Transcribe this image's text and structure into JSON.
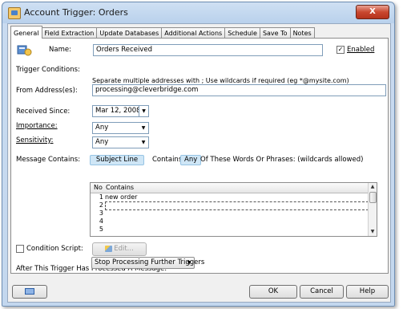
{
  "window": {
    "title": "Account Trigger: Orders",
    "close_label": "X"
  },
  "tabs": [
    {
      "label": "General"
    },
    {
      "label": "Field Extraction"
    },
    {
      "label": "Update Databases"
    },
    {
      "label": "Additional Actions"
    },
    {
      "label": "Schedule"
    },
    {
      "label": "Save To"
    },
    {
      "label": "Notes"
    }
  ],
  "general": {
    "name_label": "Name:",
    "name_value": "Orders Received",
    "enabled_label": "Enabled",
    "enabled_checked": true,
    "trigger_conditions_label": "Trigger Conditions:",
    "address_hint": "Separate multiple addresses with ; Use wildcards if required (eg *@mysite.com)",
    "from_label": "From Address(es):",
    "from_value": "processing@cleverbridge.com",
    "received_since_label": "Received Since:",
    "received_since_value": "Mar 12, 2008",
    "importance_label": "Importance:",
    "importance_value": "Any",
    "sensitivity_label": "Sensitivity:",
    "sensitivity_value": "Any",
    "message_contains_label": "Message Contains:",
    "subject_line": "Subject Line",
    "contains_word": "Contains",
    "any_word": "Any",
    "phrases_text": "Of These Words Or Phrases: (wildcards allowed)",
    "grid_columns": [
      "No",
      "Contains"
    ],
    "grid_rows": [
      {
        "no": "1",
        "text": "new order"
      },
      {
        "no": "2",
        "text": ""
      },
      {
        "no": "3",
        "text": ""
      },
      {
        "no": "4",
        "text": ""
      },
      {
        "no": "5",
        "text": ""
      }
    ],
    "condition_script_label": "Condition Script:",
    "condition_script_checked": false,
    "edit_button": "Edit...",
    "after_processed_label": "After This Trigger Has Processed A Message:",
    "after_action_value": "Stop Processing Further Triggers"
  },
  "footer": {
    "ok": "OK",
    "cancel": "Cancel",
    "help": "Help"
  },
  "colors": {
    "title_bar": "#c3d7ee",
    "close_button": "#c9472f",
    "highlight_pill": "#cfe6f6"
  }
}
